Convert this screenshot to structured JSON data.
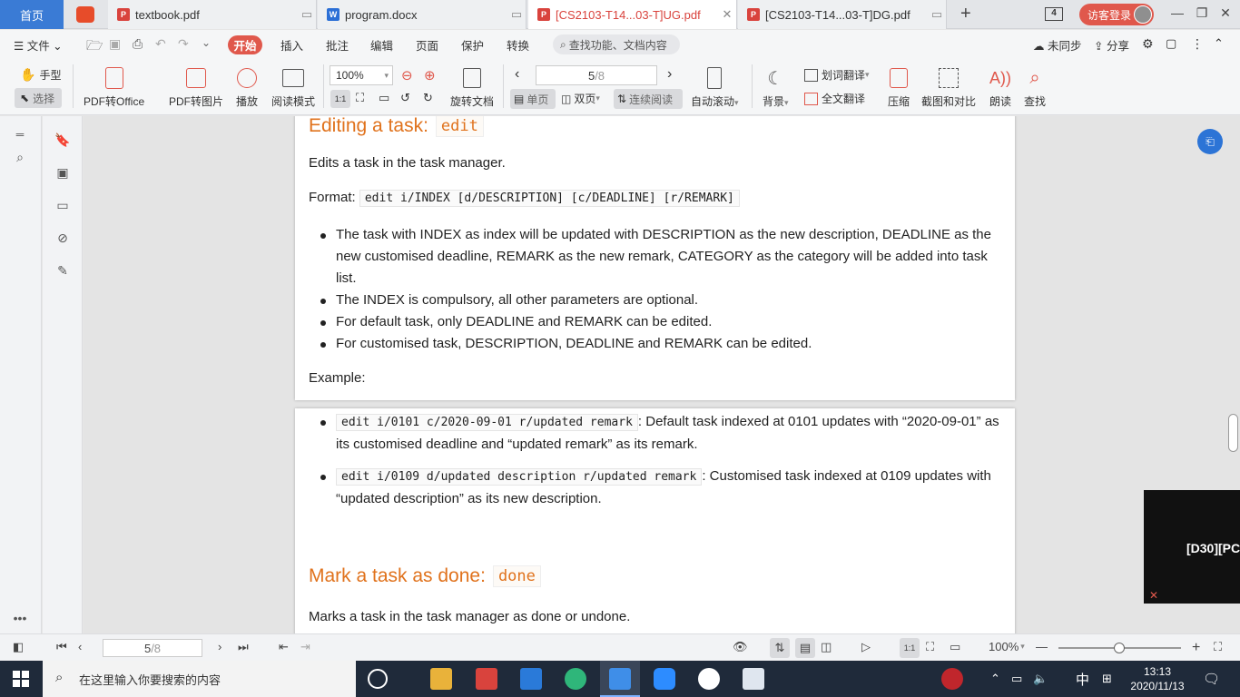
{
  "tabs": {
    "home": "首页",
    "items": [
      {
        "label": "textbook.pdf",
        "type": "pdf"
      },
      {
        "label": "program.docx",
        "type": "doc"
      },
      {
        "label": "[CS2103-T14...03-T]UG.pdf",
        "type": "pdf"
      },
      {
        "label": "[CS2103-T14...03-T]DG.pdf",
        "type": "pdf"
      }
    ],
    "new_tab": "+",
    "tab_count": "4",
    "login": "访客登录"
  },
  "menu": {
    "file": "文件",
    "items": [
      "开始",
      "插入",
      "批注",
      "编辑",
      "页面",
      "保护",
      "转换"
    ],
    "search_placeholder": "查找功能、文档内容",
    "sync": "未同步",
    "share": "分享"
  },
  "ribbon": {
    "hand": "手型",
    "select": "选择",
    "pdf_office": "PDF转Office",
    "pdf_image": "PDF转图片",
    "play": "播放",
    "read_mode": "阅读模式",
    "zoom": "100%",
    "rotate": "旋转文档",
    "page_current": "5",
    "page_total": "/8",
    "single": "单页",
    "double": "双页",
    "continuous": "连续阅读",
    "autoscroll": "自动滚动",
    "background": "背景",
    "word_translate": "划词翻译",
    "full_translate": "全文翻译",
    "compress": "压缩",
    "compare": "截图和对比",
    "read_aloud": "朗读",
    "find": "查找"
  },
  "doc": {
    "edit_heading": "Editing a task:",
    "edit_code": "edit",
    "edit_desc": "Edits a task in the task manager.",
    "format_label": "Format:",
    "format_code": "edit i/INDEX [d/DESCRIPTION] [c/DEADLINE] [r/REMARK]",
    "bullets": [
      "The task with INDEX as index will be updated with DESCRIPTION as the new description, DEADLINE as the new customised deadline, REMARK as the new remark, CATEGORY as the category will be added into task list.",
      "The INDEX is compulsory, all other parameters are optional.",
      "For default task, only DEADLINE and REMARK can be edited.",
      "For customised task, DESCRIPTION, DEADLINE and REMARK can be edited."
    ],
    "example_label": "Example:",
    "examples": [
      {
        "code": "edit i/0101 c/2020-09-01 r/updated remark",
        "text": ": Default task indexed at 0101 updates with “2020-09-01” as its customised deadline and “updated remark” as its remark."
      },
      {
        "code": "edit i/0109 d/updated description r/updated remark",
        "text": ": Customised task indexed at 0109 updates with “updated description” as its new description."
      }
    ],
    "done_heading": "Mark a task as done:",
    "done_code": "done",
    "done_desc": "Marks a task in the task manager as done or undone."
  },
  "popup": "[D30][PC",
  "status": {
    "page_current": "5",
    "page_total": "/8",
    "zoom": "100%"
  },
  "taskbar": {
    "search_placeholder": "在这里输入你要搜索的内容",
    "ime": "中",
    "time": "13:13",
    "date": "2020/11/13"
  }
}
